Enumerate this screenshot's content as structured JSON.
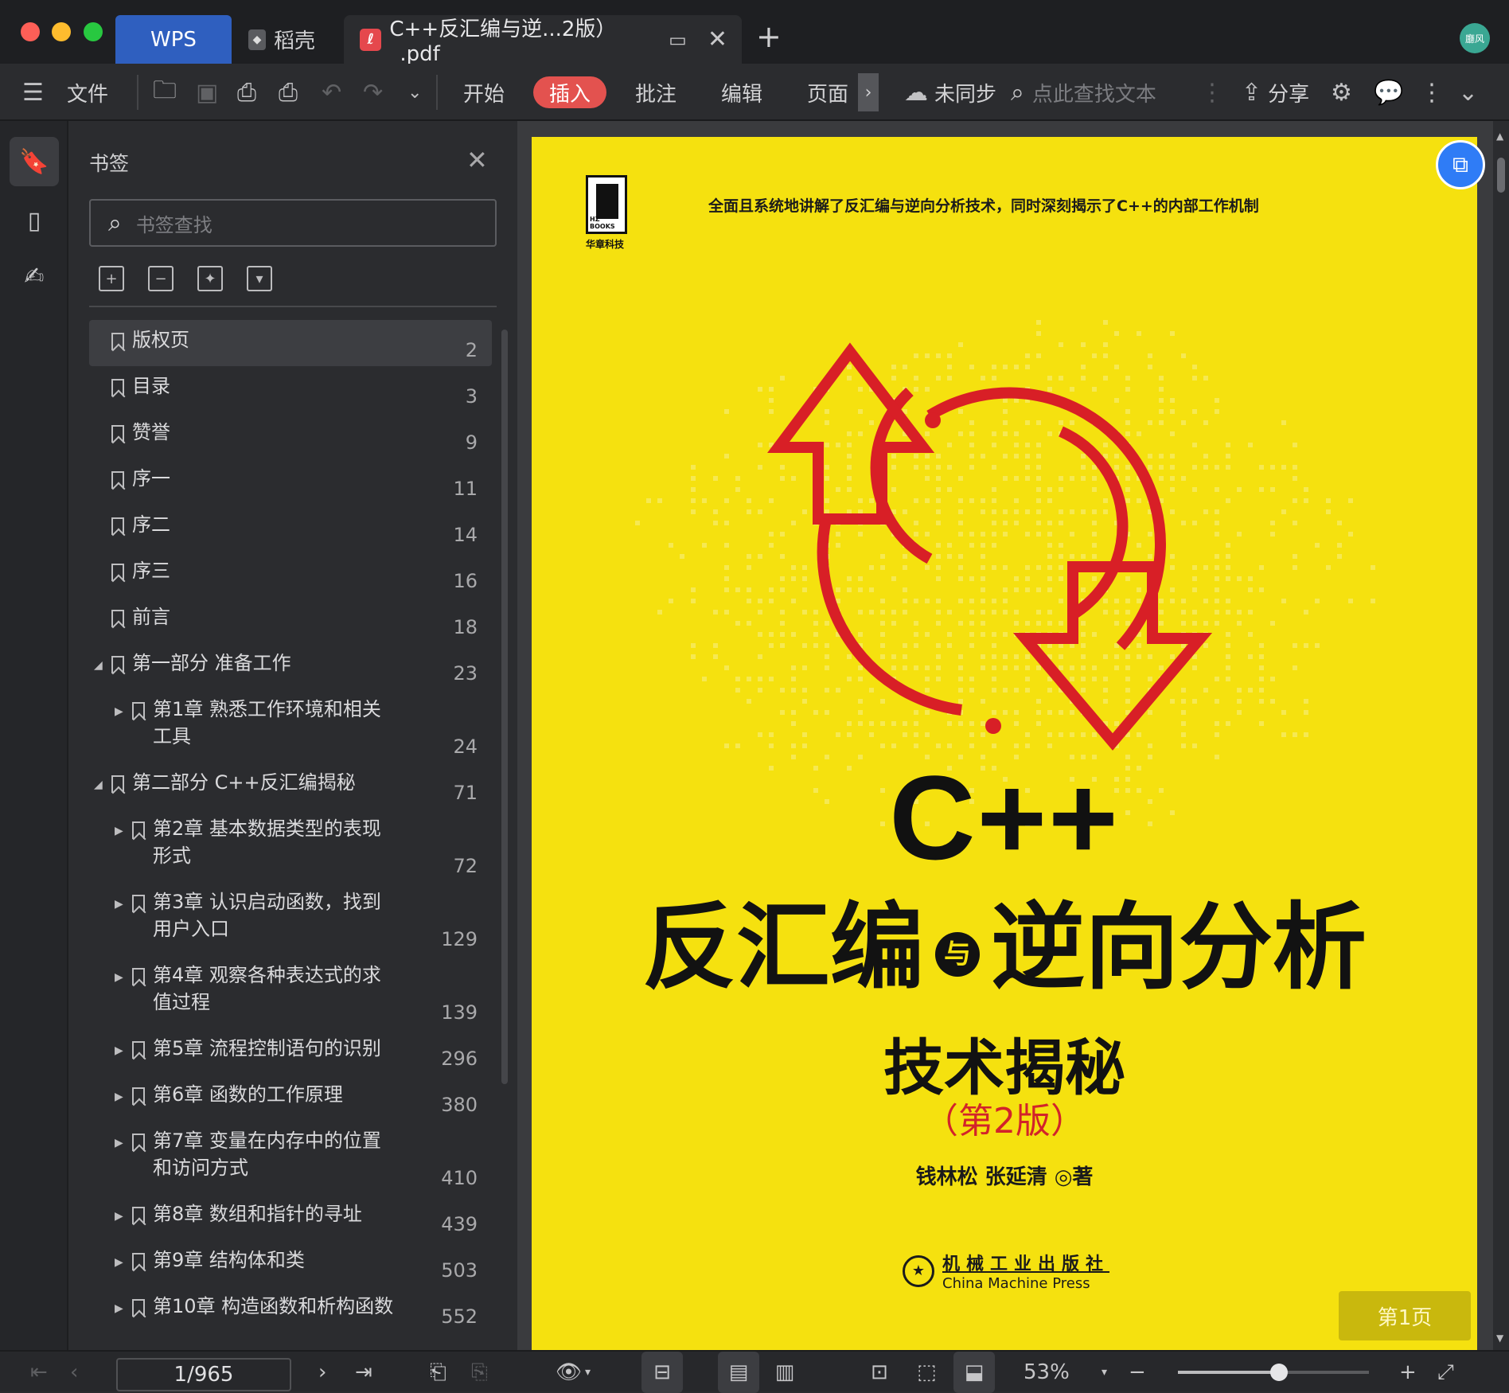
{
  "window": {
    "tabs": [
      {
        "label": "WPS"
      },
      {
        "label": "稻壳"
      },
      {
        "label": "C++反汇编与逆...2版）_.pdf"
      }
    ],
    "avatar_text": "廳风"
  },
  "toolbar": {
    "file": "文件",
    "menus": [
      "开始",
      "插入",
      "批注",
      "编辑",
      "页面"
    ],
    "active_menu": "插入",
    "sync": "未同步",
    "search_placeholder": "点此查找文本",
    "share": "分享"
  },
  "bookmarks_panel": {
    "title": "书签",
    "search_placeholder": "书签查找",
    "items": [
      {
        "label": "版权页",
        "page": "2",
        "level": 0,
        "expand": "",
        "selected": true
      },
      {
        "label": "目录",
        "page": "3",
        "level": 0,
        "expand": ""
      },
      {
        "label": "赞誉",
        "page": "9",
        "level": 0,
        "expand": ""
      },
      {
        "label": "序一",
        "page": "11",
        "level": 0,
        "expand": ""
      },
      {
        "label": "序二",
        "page": "14",
        "level": 0,
        "expand": ""
      },
      {
        "label": "序三",
        "page": "16",
        "level": 0,
        "expand": ""
      },
      {
        "label": "前言",
        "page": "18",
        "level": 0,
        "expand": ""
      },
      {
        "label": "第一部分 准备工作",
        "page": "23",
        "level": 0,
        "expand": "expanded"
      },
      {
        "label": "第1章 熟悉工作环境和相关工具",
        "lines": [
          "第1章 熟悉工作环境和相关",
          "工具"
        ],
        "page": "24",
        "level": 1,
        "expand": "collapsed"
      },
      {
        "label": "第二部分 C++反汇编揭秘",
        "page": "71",
        "level": 0,
        "expand": "expanded"
      },
      {
        "label": "第2章 基本数据类型的表现形式",
        "lines": [
          "第2章 基本数据类型的表现",
          "形式"
        ],
        "page": "72",
        "level": 1,
        "expand": "collapsed"
      },
      {
        "label": "第3章 认识启动函数，找到用户入口",
        "lines": [
          "第3章 认识启动函数，找到",
          "用户入口"
        ],
        "page": "129",
        "level": 1,
        "expand": "collapsed"
      },
      {
        "label": "第4章 观察各种表达式的求值过程",
        "lines": [
          "第4章 观察各种表达式的求",
          "值过程"
        ],
        "page": "139",
        "level": 1,
        "expand": "collapsed"
      },
      {
        "label": "第5章 流程控制语句的识别",
        "page": "296",
        "level": 1,
        "expand": "collapsed"
      },
      {
        "label": "第6章 函数的工作原理",
        "page": "380",
        "level": 1,
        "expand": "collapsed"
      },
      {
        "label": "第7章 变量在内存中的位置和访问方式",
        "lines": [
          "第7章 变量在内存中的位置",
          "和访问方式"
        ],
        "page": "410",
        "level": 1,
        "expand": "collapsed"
      },
      {
        "label": "第8章 数组和指针的寻址",
        "page": "439",
        "level": 1,
        "expand": "collapsed"
      },
      {
        "label": "第9章 结构体和类",
        "page": "503",
        "level": 1,
        "expand": "collapsed"
      },
      {
        "label": "第10章 构造函数和析构函数",
        "page": "552",
        "level": 1,
        "expand": "collapsed"
      }
    ]
  },
  "cover": {
    "publisher_logo_text": "HZ BOOKS",
    "publisher_logo_sub": "华章科技",
    "tagline": "全面且系统地讲解了反汇编与逆向分析技术，同时深刻揭示了C++的内部工作机制",
    "title_code": "C++",
    "title_left": "反汇编",
    "title_connector": "与",
    "title_right": "逆向分析",
    "subtitle": "技术揭秘",
    "edition": "（第2版）",
    "authors": "钱林松 张延清 ◎著",
    "publisher_cn": "机械工业出版社",
    "publisher_en": "China Machine Press",
    "accent_red": "#d2232a",
    "background": "#f5e10f"
  },
  "page_badge": "第1页",
  "statusbar": {
    "page_indicator": "1/965",
    "zoom": "53%",
    "zoom_fraction": 0.53
  },
  "colors": {
    "active_tab_wps": "#2f5fbf",
    "insert_highlight": "#e3524f"
  }
}
